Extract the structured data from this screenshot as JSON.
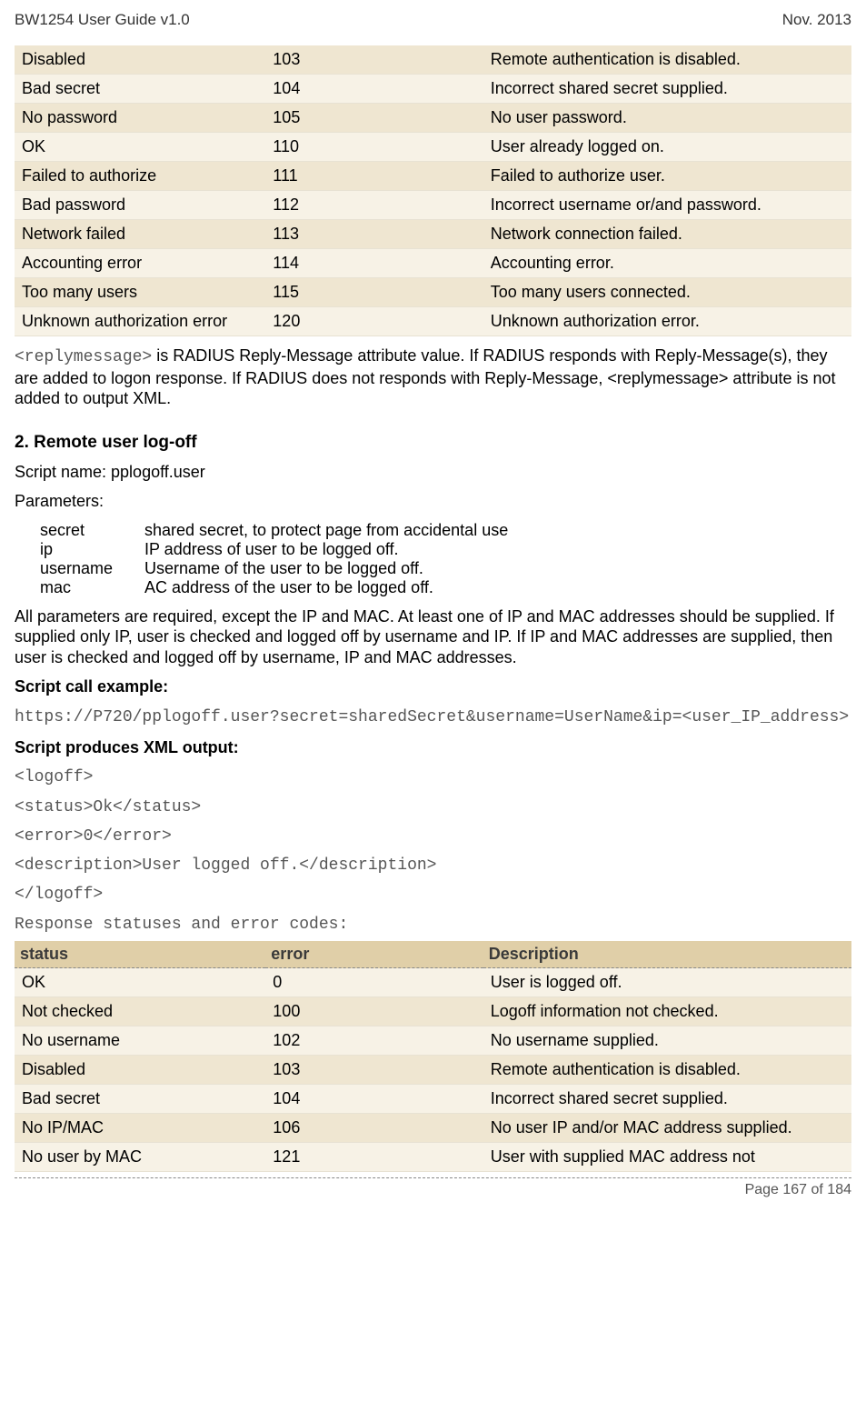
{
  "header": {
    "left": "BW1254 User Guide v1.0",
    "right": "Nov.  2013"
  },
  "table1": {
    "rows": [
      {
        "status": "Disabled",
        "error": "103",
        "desc": "Remote authentication is disabled."
      },
      {
        "status": "Bad secret",
        "error": "104",
        "desc": "Incorrect shared secret supplied."
      },
      {
        "status": "No password",
        "error": "105",
        "desc": "No user password."
      },
      {
        "status": "OK",
        "error": "110",
        "desc": "User already logged on."
      },
      {
        "status": "Failed to authorize",
        "error": "111",
        "desc": "Failed to authorize user."
      },
      {
        "status": "Bad password",
        "error": "112",
        "desc": "Incorrect username or/and password."
      },
      {
        "status": "Network failed",
        "error": "113",
        "desc": "Network connection failed."
      },
      {
        "status": "Accounting error",
        "error": "114",
        "desc": "Accounting error."
      },
      {
        "status": "Too many users",
        "error": "115",
        "desc": "Too many users connected."
      },
      {
        "status": "Unknown authorization error",
        "error": "120",
        "desc": "Unknown authorization error."
      }
    ]
  },
  "replymsg": {
    "tag": "<replymessage>",
    "text": " is RADIUS Reply-Message attribute value. If RADIUS responds with Reply-Message(s), they are added to logon response. If RADIUS does not responds with Reply-Message, <replymessage> attribute is not added to output XML."
  },
  "section2": {
    "title": "2. Remote user log-off",
    "script_line": "Script name: pplogoff.user",
    "params_label": "Parameters:",
    "params": [
      {
        "k": "secret",
        "v": "shared secret, to protect page from accidental use"
      },
      {
        "k": "ip",
        "v": "IP address of user to be logged off."
      },
      {
        "k": "username",
        "v": "Username of the user to be logged off."
      },
      {
        "k": "mac",
        "v": "AC address of the user to be logged off."
      }
    ],
    "param_note": "All parameters are required, except the IP and MAC. At least one of IP and MAC addresses should be supplied. If supplied only IP, user is checked and logged off by username and IP. If IP and MAC addresses are supplied, then user is checked and logged off by username, IP and MAC addresses.",
    "call_label": "Script call example:",
    "call_code": "https://P720/pplogoff.user?secret=sharedSecret&username=UserName&ip=<user_IP_address>",
    "xml_label": "Script produces XML output:",
    "xml_lines": [
      "<logoff>",
      "<status>Ok</status>",
      "<error>0</error>",
      "<description>User logged off.</description>",
      "</logoff>"
    ],
    "resp_label": "Response statuses and error codes:"
  },
  "table2": {
    "headers": {
      "c1": "status",
      "c2": "error",
      "c3": "Description"
    },
    "rows": [
      {
        "status": "OK",
        "error": "0",
        "desc": "User is logged off."
      },
      {
        "status": "Not checked",
        "error": "100",
        "desc": "Logoff information not checked."
      },
      {
        "status": "No username",
        "error": "102",
        "desc": "No username supplied."
      },
      {
        "status": "Disabled",
        "error": "103",
        "desc": "Remote authentication is disabled."
      },
      {
        "status": "Bad secret",
        "error": "104",
        "desc": "Incorrect shared secret supplied."
      },
      {
        "status": "No IP/MAC",
        "error": "106",
        "desc": "No user IP and/or MAC address supplied."
      },
      {
        "status": "No user by MAC",
        "error": "121",
        "desc": "User with supplied MAC address not"
      }
    ]
  },
  "footer": {
    "page": "Page 167 of 184"
  }
}
